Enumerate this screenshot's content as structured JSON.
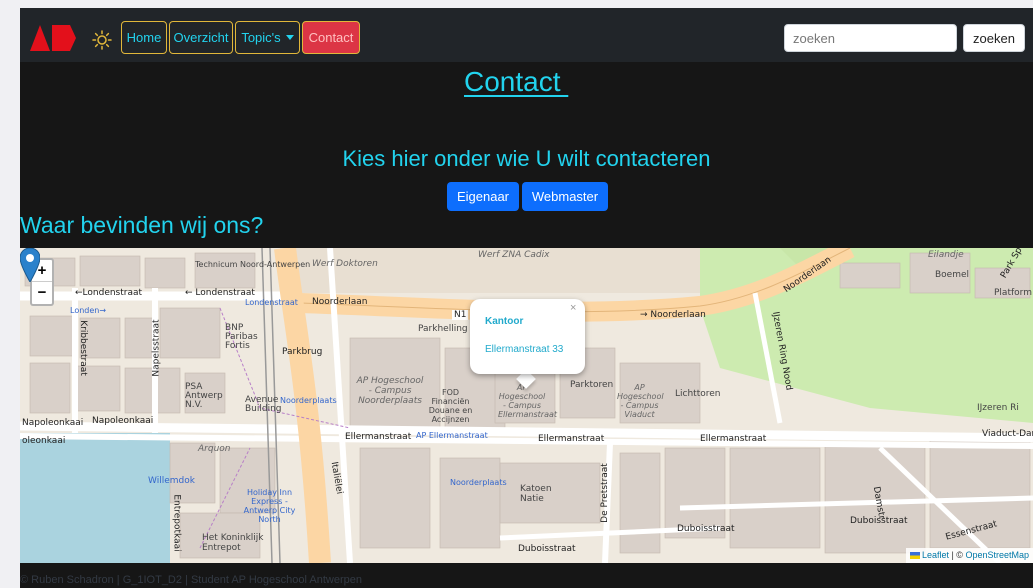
{
  "nav": {
    "home": "Home",
    "overzicht": "Overzicht",
    "topics": "Topic's",
    "contact": "Contact"
  },
  "search": {
    "placeholder": "zoeken",
    "button": "zoeken"
  },
  "colors": {
    "accent": "#22d3ee",
    "nav_border": "#e1b73a",
    "active": "#dc3545",
    "primary_button": "#0d6efd"
  },
  "icons": {
    "logo": "ap-logo",
    "theme": "sun-icon",
    "marker": "map-marker-icon"
  },
  "page": {
    "title": "Contact ",
    "contact_heading": "Kies hier onder wie U wilt contacteren",
    "buttons": {
      "eigenaar": "Eigenaar",
      "webmaster": "Webmaster"
    },
    "location_heading": "Waar bevinden wij ons?"
  },
  "map": {
    "zoom_in": "+",
    "zoom_out": "−",
    "popup": {
      "title": "Kantoor",
      "text": "Ellermanstraat 33",
      "close": "×"
    },
    "attribution": {
      "leaflet": "Leaflet",
      "separator": " | © ",
      "osm": "OpenStreetMap"
    },
    "labels": {
      "werf_zna_cadix": "Werf ZNA Cadix",
      "werf_doktoren": "Werf Doktoren",
      "technicum": "Technicum Noord-Antwerpen",
      "londenstraat_1": "←Londenstraat",
      "londenstraat_2": "← Londenstraat",
      "londenstraat_3": "Londenstraat",
      "londen": "Londen→",
      "noorderlaan_1": "Noorderlaan",
      "noorderlaan_2": "→ Noorderlaan",
      "noorderlaan_3": "Noorderlaan",
      "n1": "N1",
      "parkhelling": "Parkhelling",
      "bnp": "BNP Paribas Fortis",
      "parkbrug": "Parkbrug",
      "psa": "PSA Antwerp N.V.",
      "avenue": "Avenue Building",
      "noorderplaats_1": "Noorderplaats",
      "ap_noorderplaats": "AP Hogeschool - Campus Noorderplaats",
      "fod": "FOD Financiën Douane en Accijnzen",
      "ap_ellermanstraat": "AP Hogeschool - Campus Ellermanstraat",
      "parktoren": "Parktoren",
      "ap_viaduct": "AP Hogeschool - Campus Viaduct",
      "lichttoren": "Lichttoren",
      "ijzeren_ring": "IJzeren Ri",
      "platform": "Platform",
      "boemel": "Boemel",
      "eilandje": "Eilandje",
      "park_spoor": "Park Sp",
      "napoleonkaai_1": "Napoleonkaai",
      "napoleonkaai_2": "Napoleonkaai",
      "napoleonkaai_3": "oleonkaai",
      "ellermanstraat_1": "Ellermanstraat",
      "ellermanstraat_2": "AP Ellermanstraat",
      "ellermanstraat_3": "Ellermanstraat",
      "ellermanstraat_4": "Ellermanstraat",
      "viaduct_dam": "Viaduct-Dam",
      "arquon": "Arquon",
      "willemdok": "Willemdok",
      "holiday_inn": "Holiday Inn Express - Antwerp City North",
      "koninklijk": "Het Koninklijk Entrepot",
      "entrepotkaai": "Entrepotkaai",
      "italielei": "Italiëlei",
      "noorderplaats_2": "Noorderplaats",
      "katoen": "Katoen Natie",
      "de_pretstraat": "De Pretstraat",
      "duboisstraat_1": "Duboisstraat",
      "duboisstraat_2": "Duboisstraat",
      "duboisstraat_3": "Duboisstraat",
      "damstraat": "Damstr",
      "essenstraat": "Essenstraat",
      "kribbestraat": "Kribbestraat",
      "napelsstraat": "Napelsstraat",
      "ijzerlaan": "IJzeren Ring Nood"
    }
  },
  "footer": "© Ruben Schadron | G_1IOT_D2 | Student AP Hogeschool Antwerpen"
}
